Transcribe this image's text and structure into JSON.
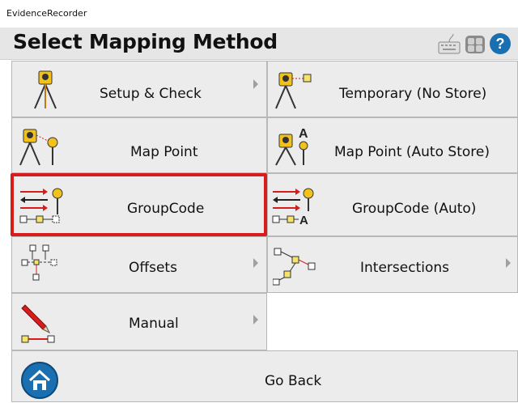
{
  "window": {
    "title": "EvidenceRecorder"
  },
  "header": {
    "title": "Select Mapping Method",
    "icons": [
      "keyboard-icon",
      "calculator-icon",
      "help-icon"
    ]
  },
  "buttons": {
    "setup_check": "Setup & Check",
    "temporary": "Temporary (No Store)",
    "map_point": "Map Point",
    "map_point_auto": "Map Point (Auto Store)",
    "groupcode": "GroupCode",
    "groupcode_auto": "GroupCode (Auto)",
    "offsets": "Offsets",
    "intersections": "Intersections",
    "manual": "Manual",
    "go_back": "Go Back"
  },
  "colors": {
    "highlight": "#d81c1c",
    "accent_blue": "#1a6fb0",
    "button_bg": "#ececec"
  }
}
